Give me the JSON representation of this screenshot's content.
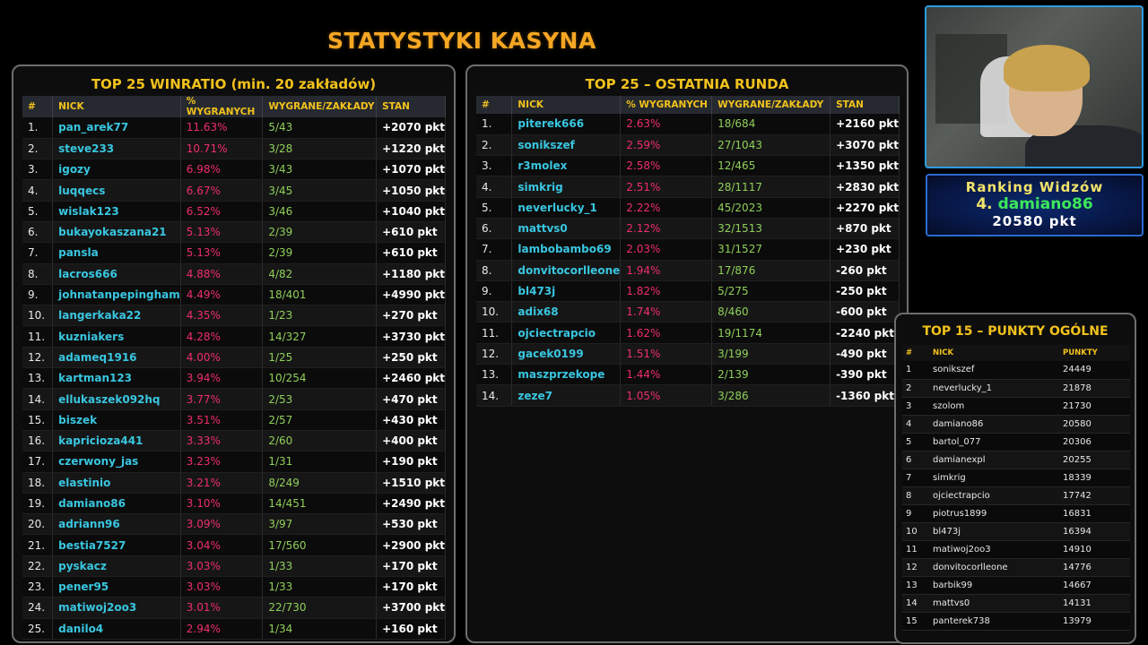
{
  "title": "STATYSTYKI KASYNA",
  "winratio": {
    "title": "TOP 25 WINRATIO (min. 20 zakładów)",
    "headers": [
      "#",
      "NICK",
      "% WYGRANYCH",
      "WYGRANE/ZAKŁADY",
      "STAN"
    ],
    "rows": [
      [
        "1.",
        "pan_arek77",
        "11.63%",
        "5/43",
        "+2070 pkt"
      ],
      [
        "2.",
        "steve233",
        "10.71%",
        "3/28",
        "+1220 pkt"
      ],
      [
        "3.",
        "igozy",
        "6.98%",
        "3/43",
        "+1070 pkt"
      ],
      [
        "4.",
        "luqqecs",
        "6.67%",
        "3/45",
        "+1050 pkt"
      ],
      [
        "5.",
        "wislak123",
        "6.52%",
        "3/46",
        "+1040 pkt"
      ],
      [
        "6.",
        "bukayokaszana21",
        "5.13%",
        "2/39",
        "+610 pkt"
      ],
      [
        "7.",
        "pansla",
        "5.13%",
        "2/39",
        "+610 pkt"
      ],
      [
        "8.",
        "lacros666",
        "4.88%",
        "4/82",
        "+1180 pkt"
      ],
      [
        "9.",
        "johnatanpepingham",
        "4.49%",
        "18/401",
        "+4990 pkt"
      ],
      [
        "10.",
        "langerkaka22",
        "4.35%",
        "1/23",
        "+270 pkt"
      ],
      [
        "11.",
        "kuzniakers",
        "4.28%",
        "14/327",
        "+3730 pkt"
      ],
      [
        "12.",
        "adameq1916",
        "4.00%",
        "1/25",
        "+250 pkt"
      ],
      [
        "13.",
        "kartman123",
        "3.94%",
        "10/254",
        "+2460 pkt"
      ],
      [
        "14.",
        "ellukaszek092hq",
        "3.77%",
        "2/53",
        "+470 pkt"
      ],
      [
        "15.",
        "biszek",
        "3.51%",
        "2/57",
        "+430 pkt"
      ],
      [
        "16.",
        "kapricioza441",
        "3.33%",
        "2/60",
        "+400 pkt"
      ],
      [
        "17.",
        "czerwony_jas",
        "3.23%",
        "1/31",
        "+190 pkt"
      ],
      [
        "18.",
        "elastinio",
        "3.21%",
        "8/249",
        "+1510 pkt"
      ],
      [
        "19.",
        "damiano86",
        "3.10%",
        "14/451",
        "+2490 pkt"
      ],
      [
        "20.",
        "adriann96",
        "3.09%",
        "3/97",
        "+530 pkt"
      ],
      [
        "21.",
        "bestia7527",
        "3.04%",
        "17/560",
        "+2900 pkt"
      ],
      [
        "22.",
        "pyskacz",
        "3.03%",
        "1/33",
        "+170 pkt"
      ],
      [
        "23.",
        "pener95",
        "3.03%",
        "1/33",
        "+170 pkt"
      ],
      [
        "24.",
        "matiwoj2oo3",
        "3.01%",
        "22/730",
        "+3700 pkt"
      ],
      [
        "25.",
        "danilo4",
        "2.94%",
        "1/34",
        "+160 pkt"
      ]
    ]
  },
  "lastround": {
    "title": "TOP 25 – OSTATNIA RUNDA",
    "headers": [
      "#",
      "NICK",
      "% WYGRANYCH",
      "WYGRANE/ZAKŁADY",
      "STAN"
    ],
    "rows": [
      [
        "1.",
        "piterek666",
        "2.63%",
        "18/684",
        "+2160 pkt"
      ],
      [
        "2.",
        "sonikszef",
        "2.59%",
        "27/1043",
        "+3070 pkt"
      ],
      [
        "3.",
        "r3molex",
        "2.58%",
        "12/465",
        "+1350 pkt"
      ],
      [
        "4.",
        "simkrig",
        "2.51%",
        "28/1117",
        "+2830 pkt"
      ],
      [
        "5.",
        "neverlucky_1",
        "2.22%",
        "45/2023",
        "+2270 pkt"
      ],
      [
        "6.",
        "mattvs0",
        "2.12%",
        "32/1513",
        "+870 pkt"
      ],
      [
        "7.",
        "lambobambo69",
        "2.03%",
        "31/1527",
        "+230 pkt"
      ],
      [
        "8.",
        "donvitocorlleone",
        "1.94%",
        "17/876",
        "-260 pkt"
      ],
      [
        "9.",
        "bl473j",
        "1.82%",
        "5/275",
        "-250 pkt"
      ],
      [
        "10.",
        "adix68",
        "1.74%",
        "8/460",
        "-600 pkt"
      ],
      [
        "11.",
        "ojciectrapcio",
        "1.62%",
        "19/1174",
        "-2240 pkt"
      ],
      [
        "12.",
        "gacek0199",
        "1.51%",
        "3/199",
        "-490 pkt"
      ],
      [
        "13.",
        "maszprzekope",
        "1.44%",
        "2/139",
        "-390 pkt"
      ],
      [
        "14.",
        "zeze7",
        "1.05%",
        "3/286",
        "-1360 pkt"
      ]
    ]
  },
  "overall": {
    "title": "TOP 15 – PUNKTY OGÓLNE",
    "headers": [
      "#",
      "NICK",
      "PUNKTY"
    ],
    "rows": [
      [
        "1",
        "sonikszef",
        "24449"
      ],
      [
        "2",
        "neverlucky_1",
        "21878"
      ],
      [
        "3",
        "szolom",
        "21730"
      ],
      [
        "4",
        "damiano86",
        "20580"
      ],
      [
        "5",
        "bartol_077",
        "20306"
      ],
      [
        "6",
        "damianexpl",
        "20255"
      ],
      [
        "7",
        "simkrig",
        "18339"
      ],
      [
        "8",
        "ojciectrapcio",
        "17742"
      ],
      [
        "9",
        "piotrus1899",
        "16831"
      ],
      [
        "10",
        "bl473j",
        "16394"
      ],
      [
        "11",
        "matiwoj2oo3",
        "14910"
      ],
      [
        "12",
        "donvitocorlleone",
        "14776"
      ],
      [
        "13",
        "barbik99",
        "14667"
      ],
      [
        "14",
        "mattvs0",
        "14131"
      ],
      [
        "15",
        "panterek738",
        "13979"
      ]
    ]
  },
  "viewer_ranking": {
    "title": "Ranking Widzów",
    "position": "4.",
    "name": "damiano86",
    "points": "20580 pkt"
  },
  "colors": {
    "accent_title": "#f5a623",
    "header_yellow": "#f2c21c",
    "nick_cyan": "#39c6e0",
    "pct_pink": "#ee2e6a",
    "ratio_green": "#8fcf5a",
    "webcam_border": "#2d9be0"
  }
}
